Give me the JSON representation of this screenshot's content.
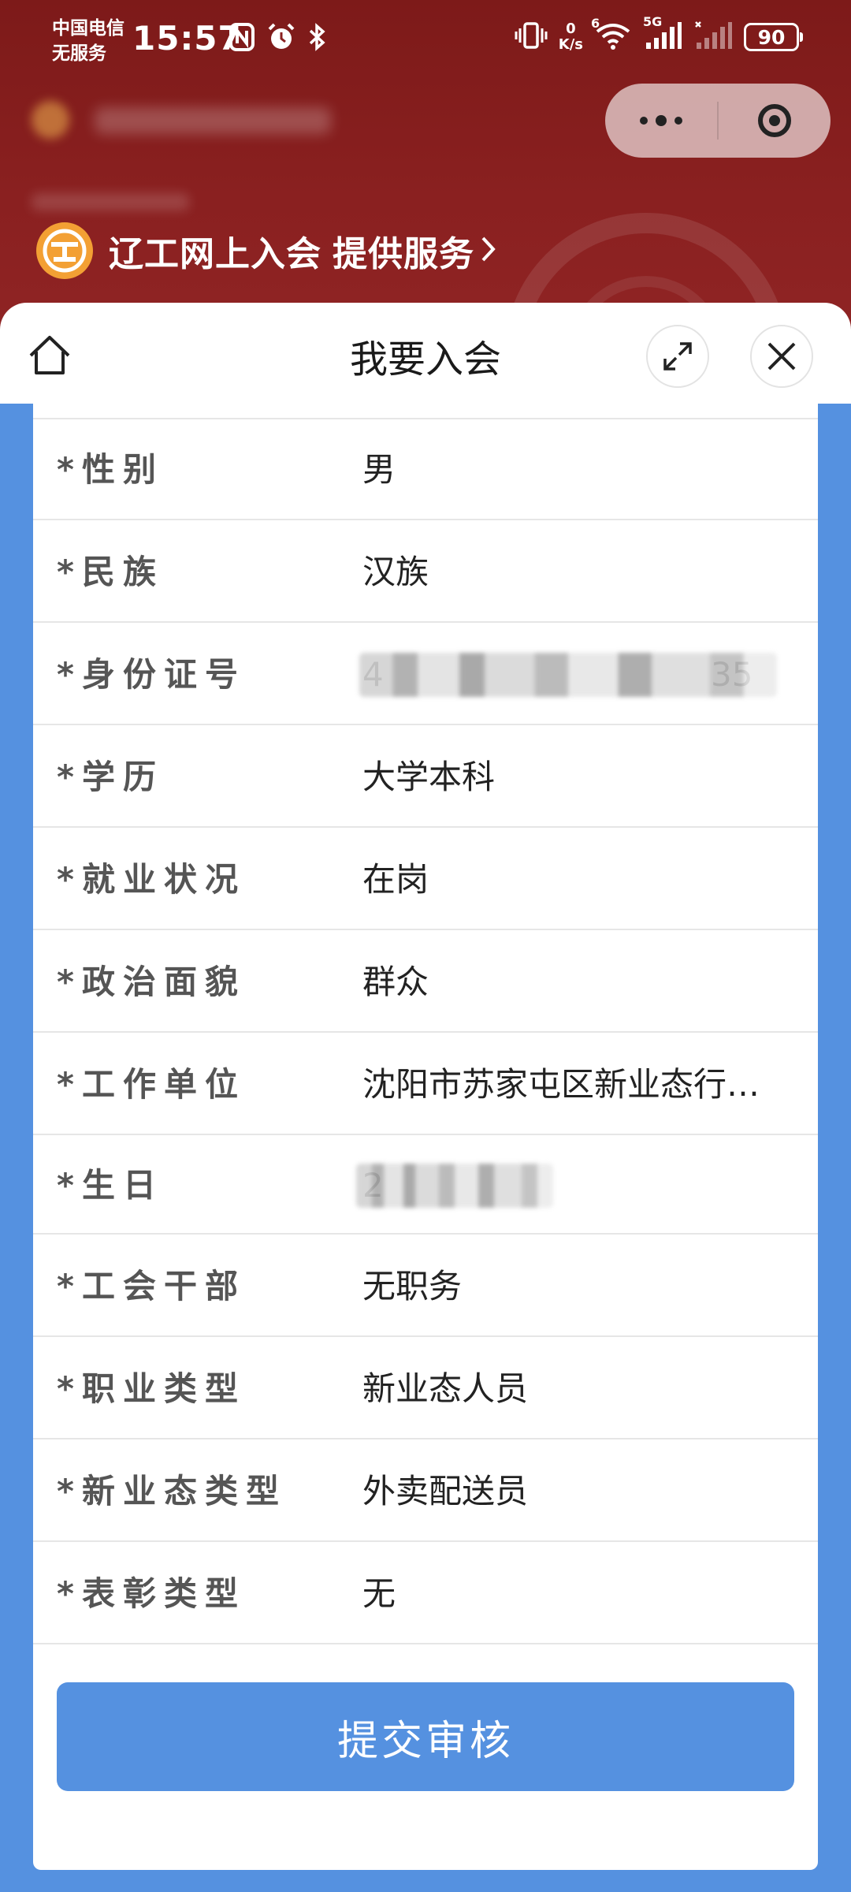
{
  "status_bar": {
    "carrier_line1": "中国电信",
    "carrier_line2": "无服务",
    "time": "15:57",
    "net_speed_value": "0",
    "net_speed_unit": "K/s",
    "wifi_badge": "6",
    "signal_badge": "5G",
    "battery": "90"
  },
  "header": {
    "service_name": "辽工网上入会",
    "service_suffix": "提供服务",
    "colors": {
      "header_red": "#8a2020",
      "logo_orange": "#f3a034"
    }
  },
  "sheet": {
    "title": "我要入会"
  },
  "form": {
    "rows": [
      {
        "label": "*性别",
        "value": "男"
      },
      {
        "label": "*民族",
        "value": "汉族"
      },
      {
        "label": "*身份证号",
        "value": "4",
        "value_tail": "35",
        "masked": true
      },
      {
        "label": "*学历",
        "value": "大学本科"
      },
      {
        "label": "*就业状况",
        "value": "在岗"
      },
      {
        "label": "*政治面貌",
        "value": "群众"
      },
      {
        "label": "*工作单位",
        "value": "沈阳市苏家屯区新业态行…"
      },
      {
        "label": "*生日",
        "value": "2",
        "masked": true
      },
      {
        "label": "*工会干部",
        "value": "无职务"
      },
      {
        "label": "*职业类型",
        "value": "新业态人员"
      },
      {
        "label": "*新业态类型",
        "value": "外卖配送员"
      },
      {
        "label": "*表彰类型",
        "value": "无"
      }
    ],
    "submit_label": "提交审核",
    "accent_color": "#5591e0"
  },
  "icons": {
    "home": "home-icon",
    "expand": "expand-icon",
    "close": "close-icon",
    "more": "more-dots-icon",
    "capsule_close": "target-icon"
  }
}
